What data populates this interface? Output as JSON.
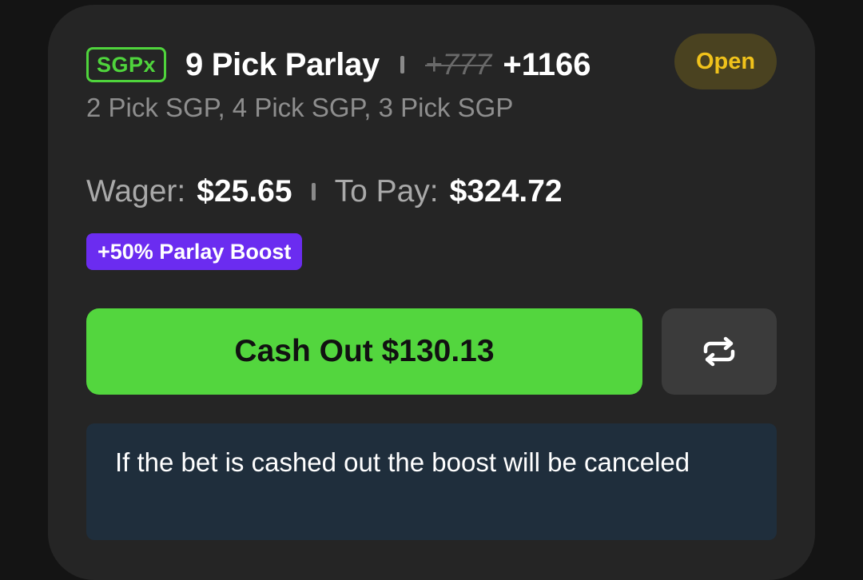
{
  "bet": {
    "badge": "SGPx",
    "title": "9 Pick Parlay",
    "original_odds": "+777",
    "boosted_odds": "+1166",
    "status": "Open",
    "legs_summary": "2 Pick SGP, 4 Pick SGP, 3 Pick SGP"
  },
  "amounts": {
    "wager_label": "Wager:",
    "wager_value": "$25.65",
    "to_pay_label": "To Pay:",
    "to_pay_value": "$324.72"
  },
  "boost": {
    "label": "+50% Parlay Boost"
  },
  "actions": {
    "cashout_label": "Cash Out $130.13",
    "swap_icon": "repeat-icon"
  },
  "info": {
    "message": "If the bet is cashed out the boost will be canceled"
  },
  "colors": {
    "accent_green": "#53d63e",
    "boost_purple": "#6b2cf0",
    "open_yellow": "#f0c21b",
    "card_bg": "#252525",
    "info_bg": "#1f2e3c"
  }
}
